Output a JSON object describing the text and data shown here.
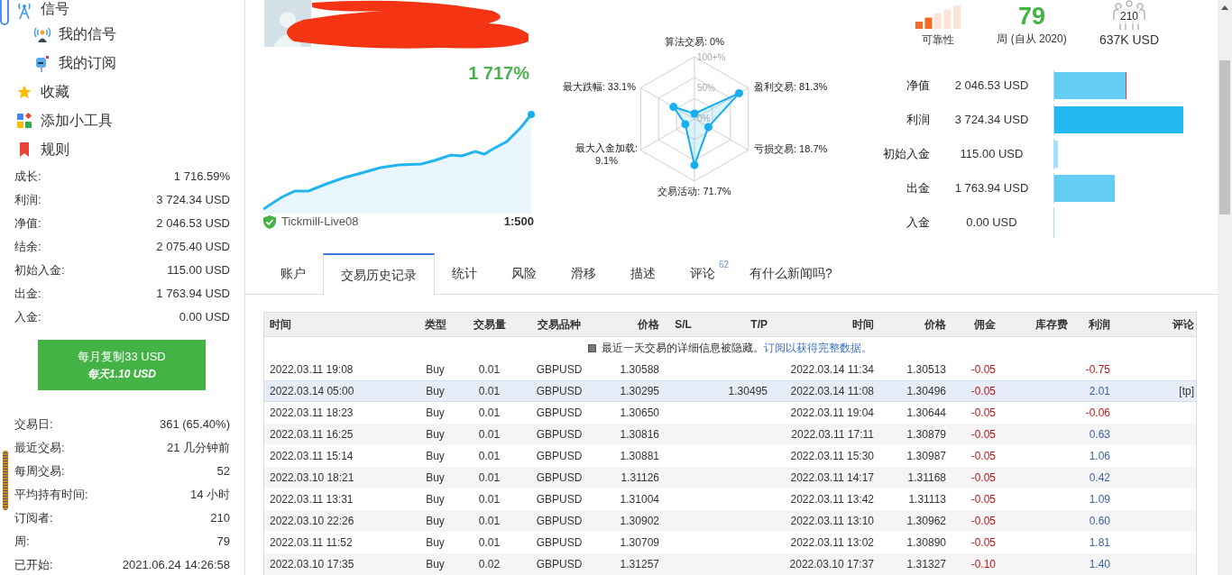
{
  "sidebar": {
    "nav": [
      {
        "label": "信号",
        "children": [
          {
            "label": "我的信号"
          },
          {
            "label": "我的订阅"
          }
        ]
      },
      {
        "label": "收藏"
      },
      {
        "label": "添加小工具"
      },
      {
        "label": "规则"
      }
    ],
    "stats": [
      {
        "label": "成长:",
        "value": "1 716.59%"
      },
      {
        "label": "利润:",
        "value": "3 724.34 USD"
      },
      {
        "label": "净值:",
        "value": "2 046.53 USD"
      },
      {
        "label": "结余:",
        "value": "2 075.40 USD"
      },
      {
        "label": "初始入金:",
        "value": "115.00 USD"
      },
      {
        "label": "出金:",
        "value": "1 763.94 USD"
      },
      {
        "label": "入金:",
        "value": "0.00 USD"
      }
    ],
    "subscribe_button": {
      "price": "每月复制33 USD",
      "daily": "每天1.10 USD"
    },
    "stats2": [
      {
        "label": "交易日:",
        "value": "361 (65.40%)"
      },
      {
        "label": "最近交易:",
        "value": "21 几分钟前"
      },
      {
        "label": "每周交易:",
        "value": "52"
      },
      {
        "label": "平均持有时间:",
        "value": "14 小时"
      },
      {
        "label": "订阅者:",
        "value": "210"
      },
      {
        "label": "周:",
        "value": "79"
      },
      {
        "label": "已开始:",
        "value": "2021.06.24 14:26:58"
      }
    ]
  },
  "growth": {
    "value": "1 717%",
    "server": "Tickmill-Live08",
    "leverage": "1:500"
  },
  "radar": {
    "ticks": [
      "100+%",
      "50%",
      "0%"
    ],
    "axes": [
      {
        "label": "算法交易: 0%"
      },
      {
        "label": "最大跌幅: 33.1%"
      },
      {
        "label": "盈利交易: 81.3%"
      },
      {
        "label": "最大入金加载:",
        "value": "9.1%"
      },
      {
        "label": "亏损交易: 18.7%"
      },
      {
        "label": "交易活动: 71.7%"
      }
    ]
  },
  "summary": {
    "reliability_label": "可靠性",
    "weeks": "79",
    "weeks_label": "周 (自从 2020)",
    "subscribers": "210",
    "funds": "637K USD"
  },
  "balance_bars": [
    {
      "label": "净值",
      "value": "2 046.53 USD",
      "level": 0.55,
      "marker": true
    },
    {
      "label": "利润",
      "value": "3 724.34 USD",
      "level": 1.0,
      "marker": false
    },
    {
      "label": "初始入金",
      "value": "115.00 USD",
      "level": 0.03,
      "marker": false
    },
    {
      "label": "出金",
      "value": "1 763.94 USD",
      "level": 0.47,
      "marker": false
    },
    {
      "label": "入金",
      "value": "0.00 USD",
      "level": 0,
      "marker": false
    }
  ],
  "tabs": [
    {
      "label": "账户",
      "selected": false
    },
    {
      "label": "交易历史记录",
      "selected": true
    },
    {
      "label": "统计",
      "selected": false
    },
    {
      "label": "风险",
      "selected": false
    },
    {
      "label": "滑移",
      "selected": false
    },
    {
      "label": "描述",
      "selected": false
    },
    {
      "label": "评论",
      "badge": "62",
      "selected": false
    },
    {
      "label": "有什么新闻吗?",
      "selected": false
    }
  ],
  "table": {
    "columns": [
      "时间",
      "类型",
      "交易量",
      "交易品种",
      "价格",
      "S/L",
      "T/P",
      "时间",
      "价格",
      "佣金",
      "库存费",
      "利润",
      "评论"
    ],
    "notice": {
      "text": "最近一天交易的详细信息被隐藏。",
      "link": "订阅以获得完整数据。"
    },
    "rows": [
      {
        "cells": [
          "2022.03.11 19:08",
          "Buy",
          "0.01",
          "GBPUSD",
          "1.30588",
          "",
          "",
          "2022.03.14 11:34",
          "1.30513",
          "-0.05",
          "",
          "-0.75",
          ""
        ],
        "loss": true,
        "selected": false
      },
      {
        "cells": [
          "2022.03.14 05:00",
          "Buy",
          "0.01",
          "GBPUSD",
          "1.30295",
          "",
          "1.30495",
          "2022.03.14 11:08",
          "1.30496",
          "-0.05",
          "",
          "2.01",
          "[tp]"
        ],
        "loss": false,
        "selected": true
      },
      {
        "cells": [
          "2022.03.11 18:23",
          "Buy",
          "0.01",
          "GBPUSD",
          "1.30650",
          "",
          "",
          "2022.03.11 19:04",
          "1.30644",
          "-0.05",
          "",
          "-0.06",
          ""
        ],
        "loss": true,
        "selected": false
      },
      {
        "cells": [
          "2022.03.11 16:25",
          "Buy",
          "0.01",
          "GBPUSD",
          "1.30816",
          "",
          "",
          "2022.03.11 17:11",
          "1.30879",
          "-0.05",
          "",
          "0.63",
          ""
        ],
        "loss": false,
        "selected": false
      },
      {
        "cells": [
          "2022.03.11 15:14",
          "Buy",
          "0.01",
          "GBPUSD",
          "1.30881",
          "",
          "",
          "2022.03.11 15:30",
          "1.30987",
          "-0.05",
          "",
          "1.06",
          ""
        ],
        "loss": false,
        "selected": false
      },
      {
        "cells": [
          "2022.03.10 18:21",
          "Buy",
          "0.01",
          "GBPUSD",
          "1.31126",
          "",
          "",
          "2022.03.11 14:17",
          "1.31168",
          "-0.05",
          "",
          "0.42",
          ""
        ],
        "loss": false,
        "selected": false
      },
      {
        "cells": [
          "2022.03.11 13:31",
          "Buy",
          "0.01",
          "GBPUSD",
          "1.31004",
          "",
          "",
          "2022.03.11 13:42",
          "1.31113",
          "-0.05",
          "",
          "1.09",
          ""
        ],
        "loss": false,
        "selected": false
      },
      {
        "cells": [
          "2022.03.10 22:26",
          "Buy",
          "0.01",
          "GBPUSD",
          "1.30902",
          "",
          "",
          "2022.03.11 13:10",
          "1.30962",
          "-0.05",
          "",
          "0.60",
          ""
        ],
        "loss": false,
        "selected": false
      },
      {
        "cells": [
          "2022.03.11 11:52",
          "Buy",
          "0.01",
          "GBPUSD",
          "1.30709",
          "",
          "",
          "2022.03.11 13:02",
          "1.30890",
          "-0.05",
          "",
          "1.81",
          ""
        ],
        "loss": false,
        "selected": false
      },
      {
        "cells": [
          "2022.03.10 17:35",
          "Buy",
          "0.02",
          "GBPUSD",
          "1.31257",
          "",
          "",
          "2022.03.10 17:37",
          "1.31327",
          "-0.10",
          "",
          "1.40",
          ""
        ],
        "loss": false,
        "selected": false
      }
    ]
  }
}
